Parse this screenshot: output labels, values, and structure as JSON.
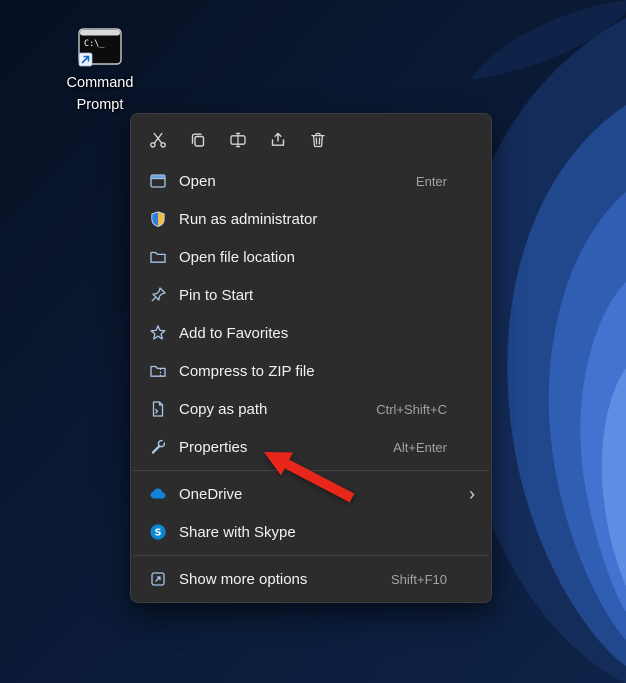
{
  "desktop": {
    "icon_label": "Command Prompt"
  },
  "toolbar": {
    "buttons": [
      "Cut",
      "Copy",
      "Rename",
      "Share",
      "Delete"
    ]
  },
  "menu": {
    "items": [
      {
        "label": "Open",
        "shortcut": "Enter"
      },
      {
        "label": "Run as administrator",
        "shortcut": ""
      },
      {
        "label": "Open file location",
        "shortcut": ""
      },
      {
        "label": "Pin to Start",
        "shortcut": ""
      },
      {
        "label": "Add to Favorites",
        "shortcut": ""
      },
      {
        "label": "Compress to ZIP file",
        "shortcut": ""
      },
      {
        "label": "Copy as path",
        "shortcut": "Ctrl+Shift+C"
      },
      {
        "label": "Properties",
        "shortcut": "Alt+Enter"
      },
      {
        "label": "OneDrive",
        "shortcut": "",
        "chevron": "›"
      },
      {
        "label": "Share with Skype",
        "shortcut": "",
        "skype_letter": "S"
      },
      {
        "label": "Show more options",
        "shortcut": "Shift+F10"
      }
    ]
  },
  "colors": {
    "menu_background": "#2c2c2c",
    "item_icon_blue": "#a8c5e8",
    "toolbar_icon_gray": "#d6d6d6",
    "onedrive_blue": "#1184d8",
    "skype_blue": "#0a86d5",
    "shield_blue": "#2f7fe3",
    "shield_gold": "#f1bd3e",
    "annotation_arrow_red": "#e8261a"
  }
}
